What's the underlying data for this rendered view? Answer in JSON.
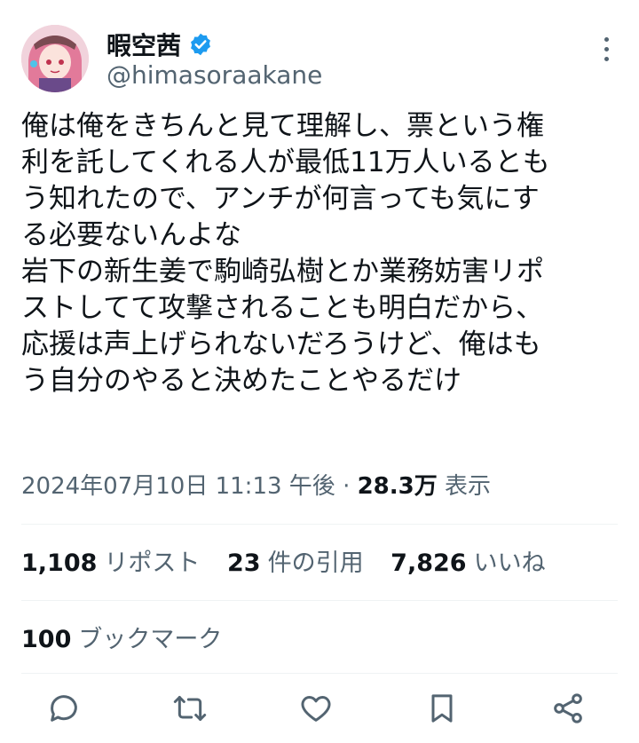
{
  "author": {
    "display_name": "暇空茜",
    "handle": "@himasoraakane"
  },
  "tweet": {
    "text": "俺は俺をきちんと見て理解し、票という権\n利を託してくれる人が最低11万人いるとも\nう知れたので、アンチが何言っても気にす\nる必要ないんよな\n岩下の新生姜で駒崎弘樹とか業務妨害リポ\nストしてて攻撃されることも明白だから、\n応援は声上げられないだろうけど、俺はも\nう自分のやると決めたことやるだけ",
    "timestamp": "2024年07月10日 11:13 午後",
    "separator": "·",
    "views_count": "28.3万",
    "views_label": "表示"
  },
  "stats": {
    "reposts_count": "1,108",
    "reposts_label": "リポスト",
    "quotes_count": "23",
    "quotes_label": "件の引用",
    "likes_count": "7,826",
    "likes_label": "いいね",
    "bookmarks_count": "100",
    "bookmarks_label": "ブックマーク"
  },
  "icons": {
    "verified": "verified-badge-icon",
    "more": "more-options-icon",
    "reply": "reply-icon",
    "repost": "repost-icon",
    "like": "like-icon",
    "bookmark": "bookmark-icon",
    "share": "share-icon"
  },
  "colors": {
    "verified_blue": "#1d9bf0",
    "secondary_text": "#536471",
    "primary_text": "#0f1419",
    "divider": "#eff3f4"
  }
}
